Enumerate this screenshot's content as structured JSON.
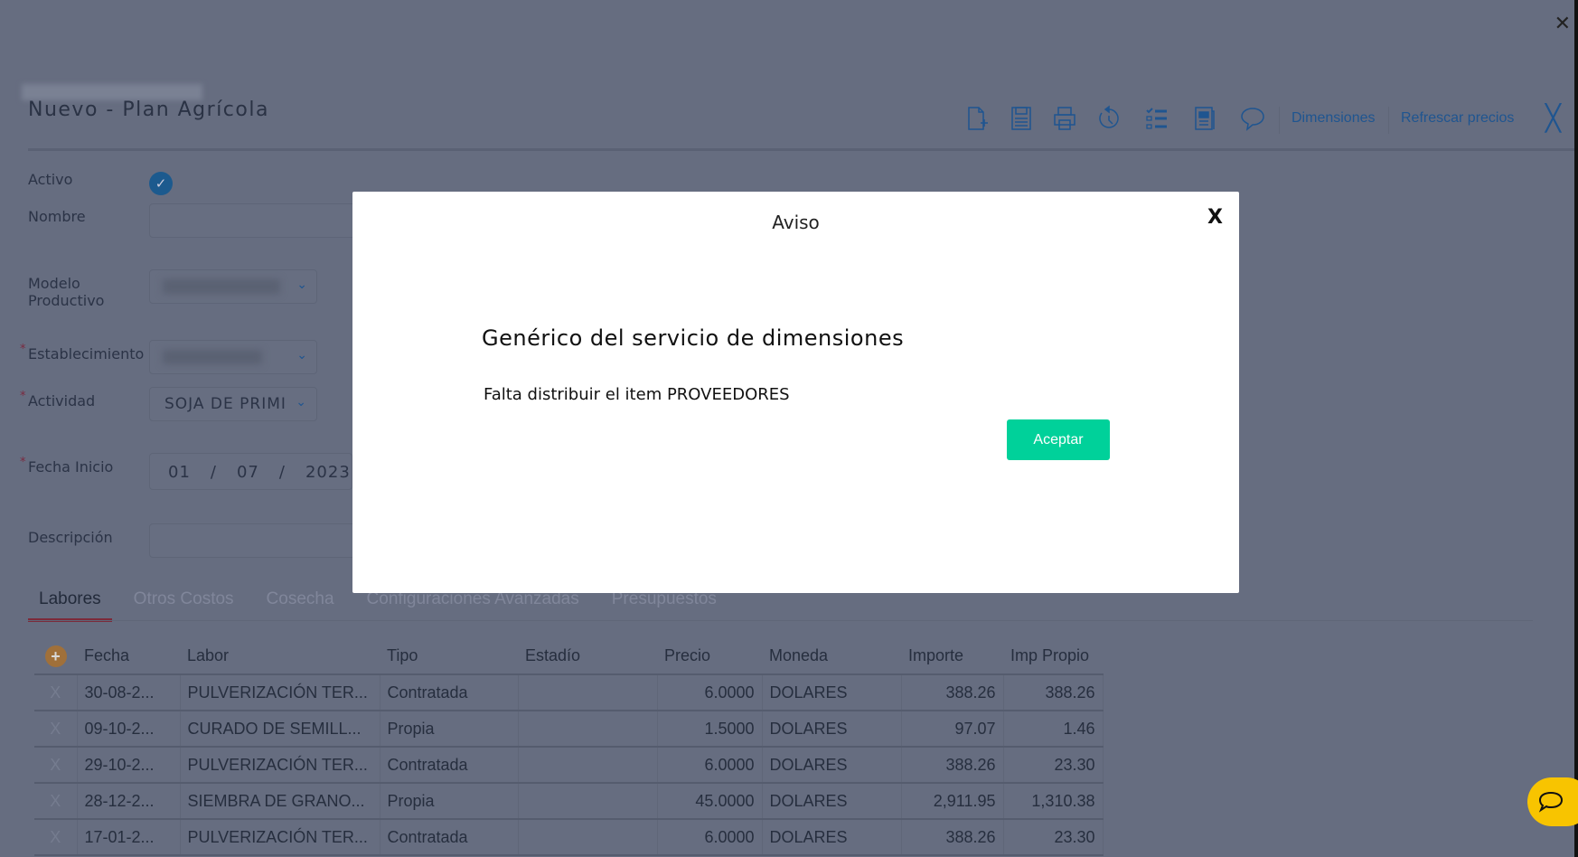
{
  "header": {
    "title": "Nuevo - Plan Agrícola",
    "links": {
      "dimensiones": "Dimensiones",
      "refrescar": "Refrescar precios"
    }
  },
  "form": {
    "activo_label": "Activo",
    "nombre_label": "Nombre",
    "modelo_label_1": "Modelo",
    "modelo_label_2": "Productivo",
    "establecimiento_label": "Establecimiento",
    "actividad_label": "Actividad",
    "actividad_value": "SOJA DE PRIMI",
    "fecha_label": "Fecha Inicio",
    "fecha_day": "01",
    "fecha_month": "07",
    "fecha_year": "2023",
    "fecha_sep": "/",
    "descripcion_label": "Descripción",
    "required_mark": "*"
  },
  "tabs": [
    "Labores",
    "Otros Costos",
    "Cosecha",
    "Configuraciones Avanzadas",
    "Presupuestos"
  ],
  "table": {
    "add_icon": "+",
    "headers": [
      "Fecha",
      "Labor",
      "Tipo",
      "Estadío",
      "Precio",
      "Moneda",
      "Importe",
      "Imp Propio"
    ],
    "delete_label": "X",
    "rows": [
      [
        "30-08-2...",
        "PULVERIZACIÓN TER...",
        "Contratada",
        "",
        "6.0000",
        "DOLARES",
        "388.26",
        "388.26"
      ],
      [
        "09-10-2...",
        "CURADO DE SEMILL...",
        "Propia",
        "",
        "1.5000",
        "DOLARES",
        "97.07",
        "1.46"
      ],
      [
        "29-10-2...",
        "PULVERIZACIÓN TER...",
        "Contratada",
        "",
        "6.0000",
        "DOLARES",
        "388.26",
        "23.30"
      ],
      [
        "28-12-2...",
        "SIEMBRA DE GRANO...",
        "Propia",
        "",
        "45.0000",
        "DOLARES",
        "2,911.95",
        "1,310.38"
      ],
      [
        "17-01-2...",
        "PULVERIZACIÓN TER...",
        "Contratada",
        "",
        "6.0000",
        "DOLARES",
        "388.26",
        "23.30"
      ]
    ]
  },
  "modal": {
    "title": "Aviso",
    "close": "X",
    "heading": "Genérico del servicio de dimensiones",
    "message": "Falta distribuir el item PROVEEDORES",
    "accept": "Aceptar"
  },
  "page_close": "✕",
  "colors": {
    "accent": "#1f6fb5",
    "accept": "#00d19a",
    "tab_active": "#b0303f",
    "chat": "#f8c400"
  }
}
